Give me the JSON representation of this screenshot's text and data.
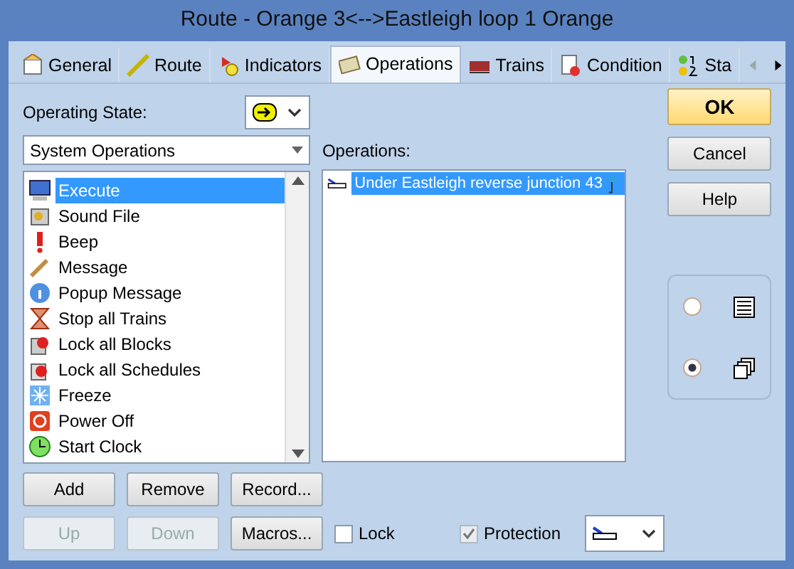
{
  "window": {
    "title": "Route - Orange 3<-->Eastleigh loop 1 Orange"
  },
  "tabs": [
    {
      "label": "General",
      "selected": false
    },
    {
      "label": "Route",
      "selected": false
    },
    {
      "label": "Indicators",
      "selected": false
    },
    {
      "label": "Operations",
      "selected": true
    },
    {
      "label": "Trains",
      "selected": false
    },
    {
      "label": "Condition",
      "selected": false
    },
    {
      "label": "Sta",
      "selected": false
    }
  ],
  "operating_state": {
    "label": "Operating State:"
  },
  "category_select": {
    "value": "System Operations"
  },
  "actions": [
    {
      "label": "Execute",
      "selected": true
    },
    {
      "label": "Sound File",
      "selected": false
    },
    {
      "label": "Beep",
      "selected": false
    },
    {
      "label": "Message",
      "selected": false
    },
    {
      "label": "Popup Message",
      "selected": false
    },
    {
      "label": "Stop all Trains",
      "selected": false
    },
    {
      "label": "Lock all Blocks",
      "selected": false
    },
    {
      "label": "Lock all Schedules",
      "selected": false
    },
    {
      "label": "Freeze",
      "selected": false
    },
    {
      "label": "Power Off",
      "selected": false
    },
    {
      "label": "Start Clock",
      "selected": false
    }
  ],
  "operations": {
    "label": "Operations:",
    "items": [
      {
        "label": "Under Eastleigh reverse junction 43",
        "selected": true
      }
    ]
  },
  "buttons": [
    {
      "label": "Add",
      "disabled": false
    },
    {
      "label": "Remove",
      "disabled": false
    },
    {
      "label": "Record...",
      "disabled": false
    },
    {
      "label": "Up",
      "disabled": true
    },
    {
      "label": "Down",
      "disabled": true
    },
    {
      "label": "Macros...",
      "disabled": false
    }
  ],
  "lock": {
    "label": "Lock",
    "checked": false
  },
  "protection": {
    "label": "Protection",
    "checked": true
  },
  "dialog_buttons": [
    {
      "label": "OK",
      "default": true
    },
    {
      "label": "Cancel",
      "default": false
    },
    {
      "label": "Help",
      "default": false
    }
  ],
  "view_options": [
    {
      "selected": false
    },
    {
      "selected": true
    }
  ]
}
